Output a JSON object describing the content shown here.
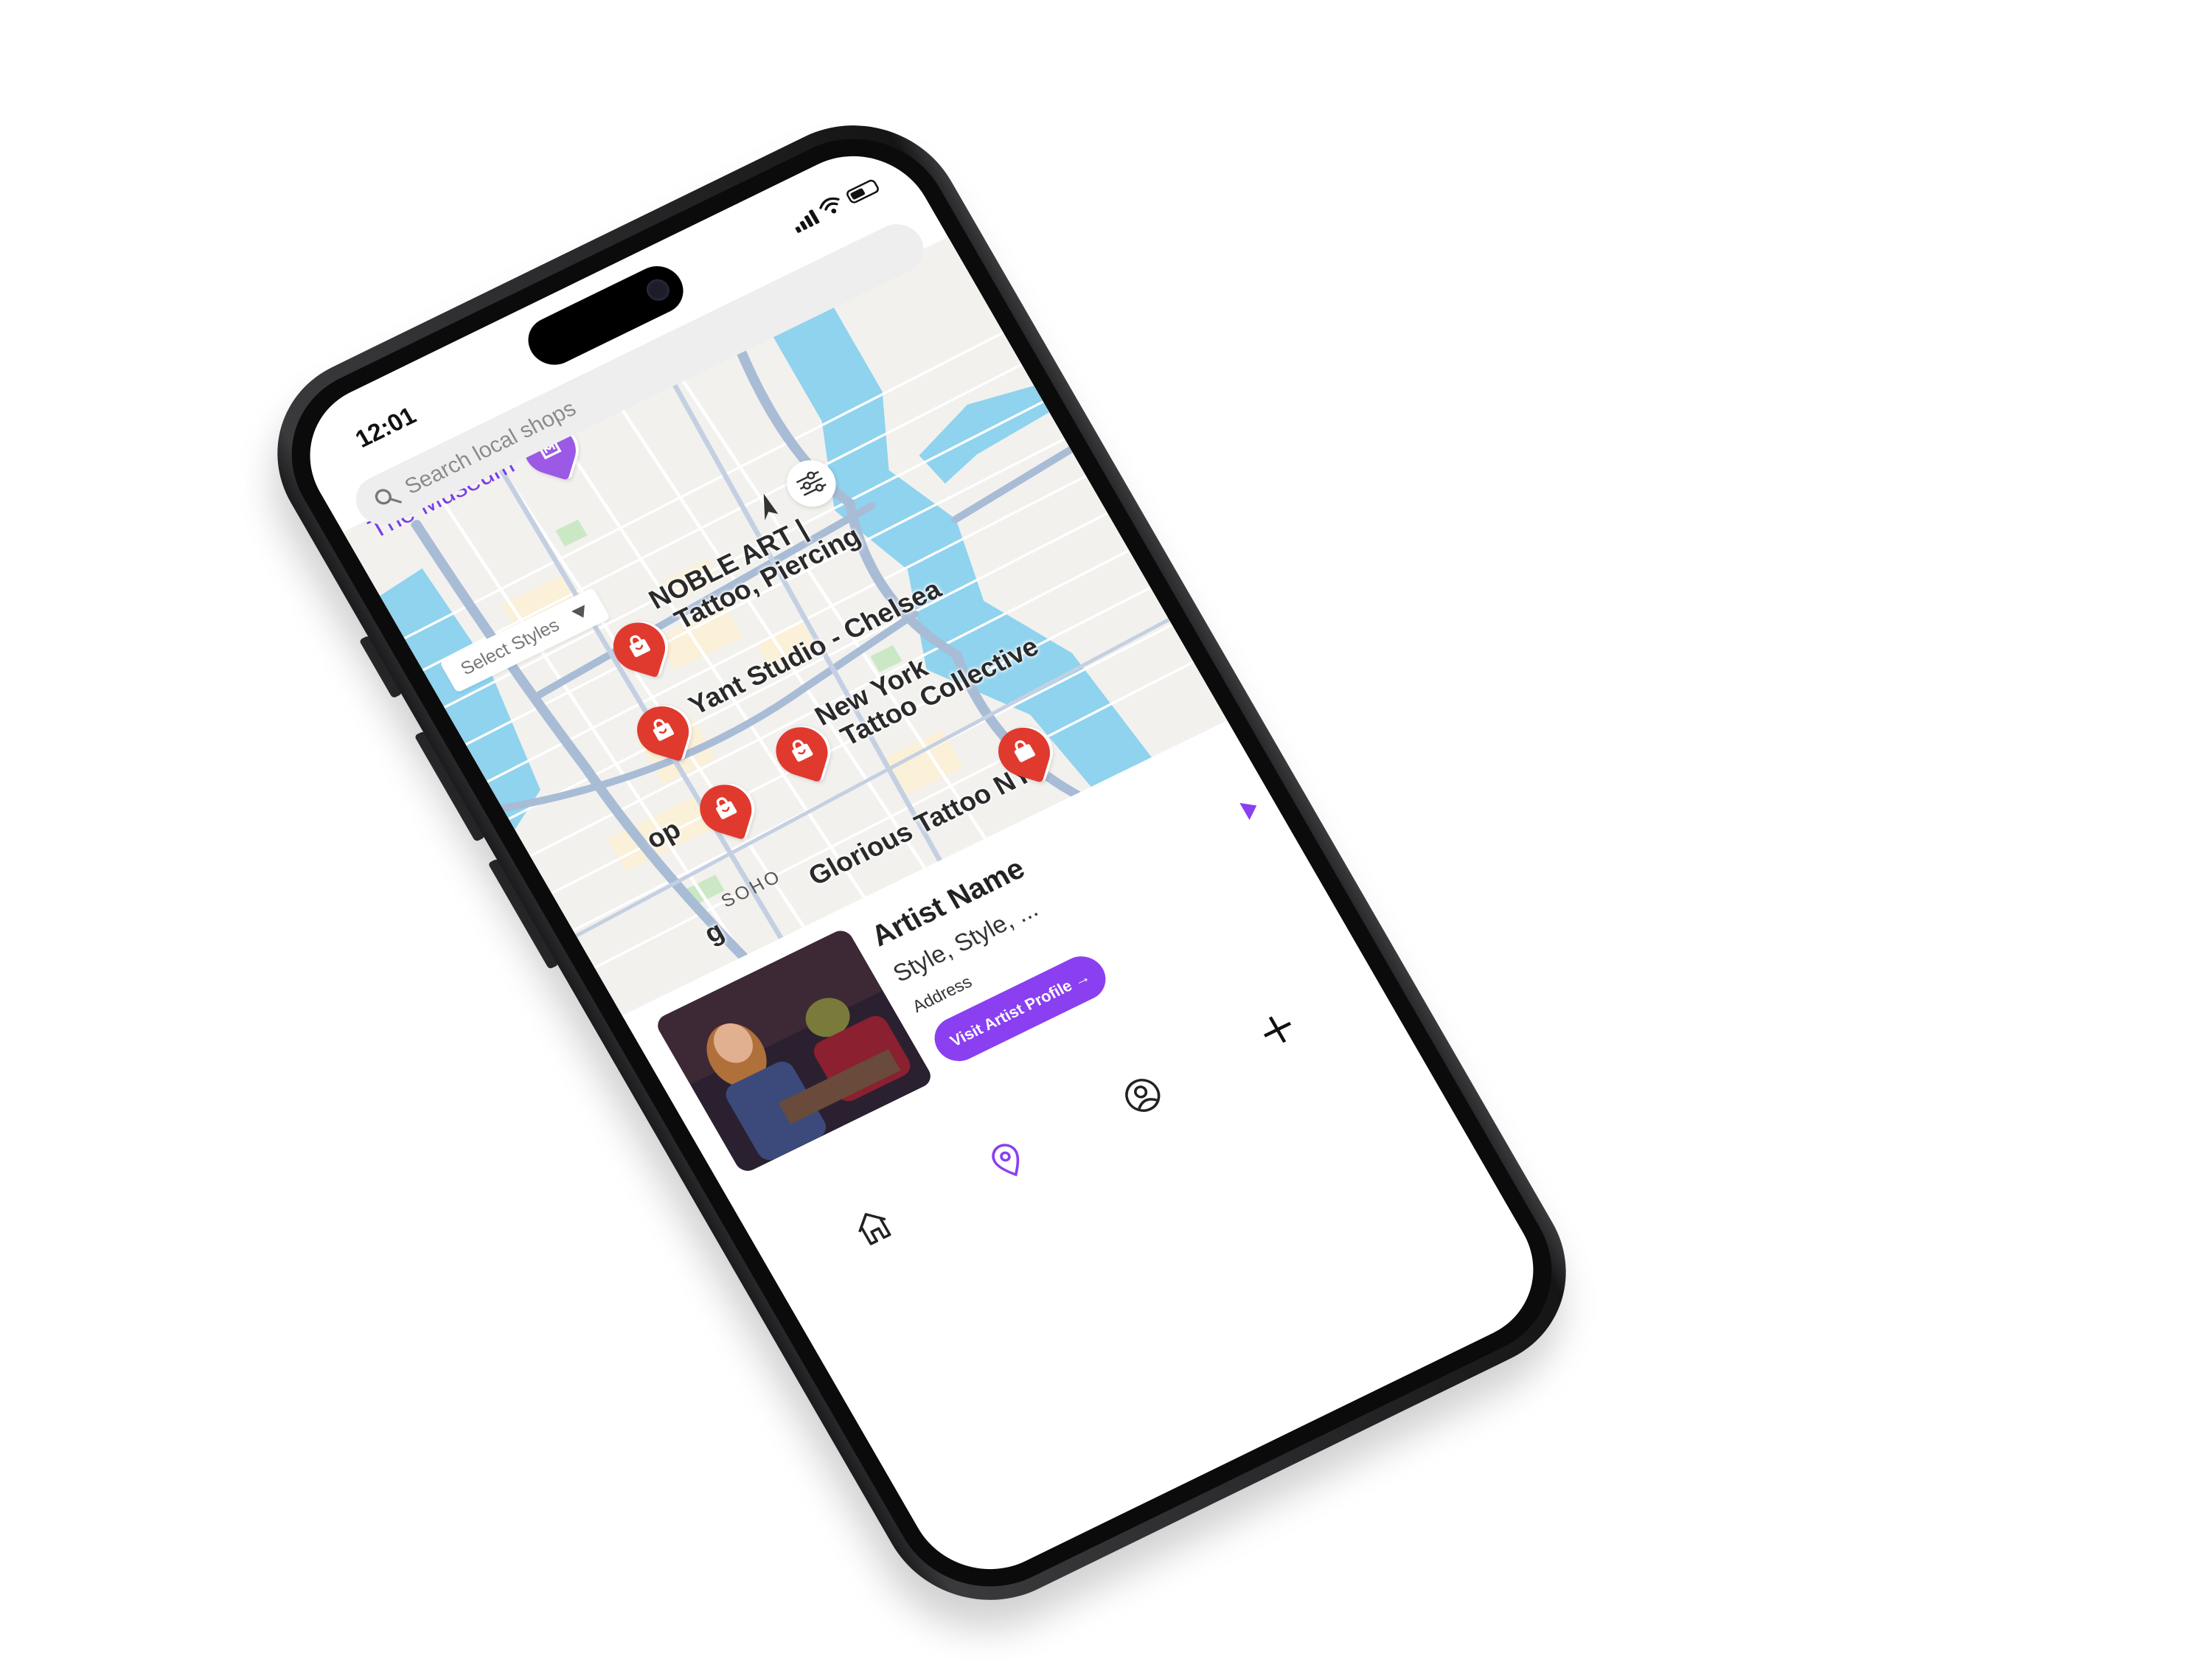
{
  "status_bar": {
    "time": "12:01"
  },
  "search": {
    "placeholder": "Search local shops"
  },
  "filter": {
    "select_label": "Select Styles"
  },
  "map": {
    "area_labels": [
      "The Museum",
      "SOHO"
    ],
    "pins": [
      {
        "label_line1": "NOBLE ART |",
        "label_line2": "Tattoo, Piercing"
      },
      {
        "label_line1": "Yant Studio - Chelsea",
        "label_line2": ""
      },
      {
        "label_line1": "New York",
        "label_line2": "Tattoo Collective"
      },
      {
        "label_line1": "Glorious Tattoo NYC",
        "label_line2": ""
      },
      {
        "label_line1": "op",
        "label_line2": ""
      },
      {
        "label_line1": "g",
        "label_line2": ""
      }
    ]
  },
  "card": {
    "artist_name": "Artist Name",
    "styles": "Style, Style, ...",
    "address": "Address",
    "visit_button": "Visit Artist Profile →"
  },
  "tabbar": {
    "items": [
      "home-icon",
      "map-pin-icon",
      "profile-icon",
      "plus-icon"
    ],
    "active": "map-pin-icon",
    "accent": "#8a3ff0"
  },
  "colors": {
    "accent": "#8a3ff0",
    "pin": "#e03a2e",
    "water": "#8fd3ee",
    "road": "#a9bcd6"
  }
}
